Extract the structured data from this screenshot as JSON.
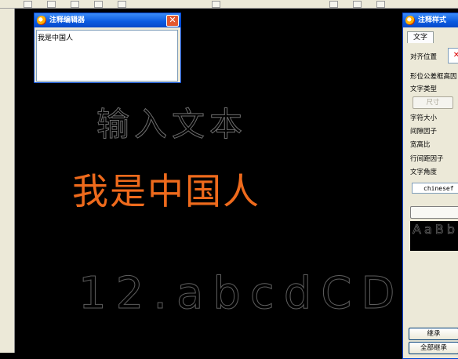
{
  "annotation_editor": {
    "title": "注释编辑器",
    "text_value": "我是中国人"
  },
  "canvas": {
    "annotation_1": "输入文本",
    "annotation_2": "我是中国人",
    "annotation_3": "12.abcdCD"
  },
  "annotation_style": {
    "title": "注释样式",
    "tab_text": "文字",
    "align_label": "对齐位置",
    "gdt_label": "形位公差框高因",
    "text_type_label": "文字类型",
    "size_button": "尺寸",
    "char_size_label": "字符大小",
    "gap_factor_label": "间隙因子",
    "aspect_ratio_label": "宽高比",
    "line_spacing_label": "行间距因子",
    "text_angle_label": "文字角度",
    "font_value": "chinesef",
    "preview_text": "AaBb",
    "inherit_button": "继承",
    "inherit_all_button": "全部继承"
  },
  "colors": {
    "highlight_text": "#ee6a1c",
    "dim_text": "#6d6d6d",
    "titlebar": "#0a5ae0"
  }
}
